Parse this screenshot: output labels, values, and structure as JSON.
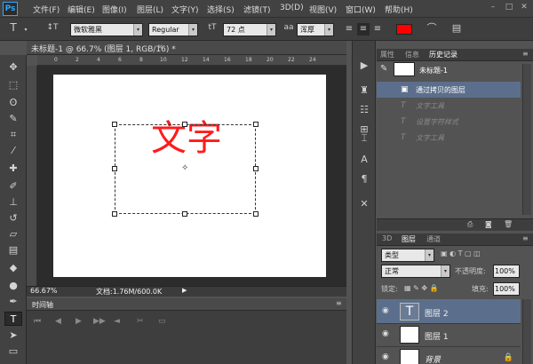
{
  "app": {
    "logo": "Ps"
  },
  "menu": [
    "文件(F)",
    "编辑(E)",
    "图像(I)",
    "图层(L)",
    "文字(Y)",
    "选择(S)",
    "滤镜(T)",
    "3D(D)",
    "视图(V)",
    "窗口(W)",
    "帮助(H)"
  ],
  "options_bar": {
    "tool_icon": "T",
    "orientation_icon": "↕T",
    "font_family": "微软雅黑",
    "font_style": "Regular",
    "font_size_icon": "tT",
    "font_size": "72 点",
    "antialias_icon": "aa",
    "antialias": "浑厚",
    "text_color": "#ff0000"
  },
  "document": {
    "tab_title": "未标题-1 @ 66.7% (图层 1, RGB/16) *",
    "text_content": "文字",
    "text_color": "#ff1b1b",
    "ruler_ticks": [
      "0",
      "2",
      "4",
      "6",
      "8",
      "10",
      "12",
      "14",
      "16",
      "18",
      "20",
      "22",
      "24"
    ]
  },
  "status": {
    "zoom": "66.67%",
    "doc_info": "文档:1.76M/600.0K"
  },
  "timeline": {
    "title": "时间轴"
  },
  "history_panel": {
    "tabs": [
      "属性",
      "信息",
      "历史记录"
    ],
    "selected_tab": "历史记录",
    "snapshot_label": "未标题-1",
    "items": [
      {
        "label": "通过拷贝的图层",
        "icon": "layer",
        "state": "selected"
      },
      {
        "label": "文字工具",
        "icon": "T",
        "state": "dim"
      },
      {
        "label": "设置字符样式",
        "icon": "T",
        "state": "dim"
      },
      {
        "label": "文字工具",
        "icon": "T",
        "state": "dim"
      }
    ]
  },
  "layers_panel": {
    "tabs": [
      "3D",
      "图层",
      "通道"
    ],
    "selected_tab": "图层",
    "kind_filter": "类型",
    "blend_mode": "正常",
    "opacity_label": "不透明度:",
    "opacity_value": "100%",
    "lock_label": "锁定:",
    "fill_label": "填充:",
    "fill_value": "100%",
    "layers": [
      {
        "name": "图层 2",
        "type": "text",
        "selected": true
      },
      {
        "name": "图层 1",
        "type": "pixel",
        "selected": false
      },
      {
        "name": "背景",
        "type": "background",
        "selected": false
      }
    ]
  }
}
